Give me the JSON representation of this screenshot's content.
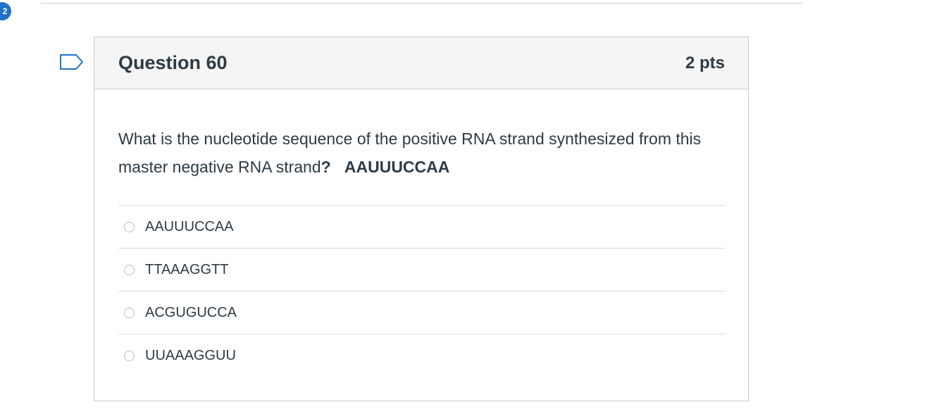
{
  "progress_badge": "2",
  "question": {
    "title": "Question 60",
    "points": "2 pts",
    "text_part1": "What is  the nucleotide  sequence  of the positive RNA strand synthesized from this master negative RNA  strand",
    "text_part2": "?",
    "text_bold": "AAUUUCCAA"
  },
  "answers": [
    {
      "label": "AAUUUCCAA",
      "selected": false
    },
    {
      "label": "TTAAAGGTT",
      "selected": false
    },
    {
      "label": "ACGUGUCCA",
      "selected": false
    },
    {
      "label": "UUAAAGGUU",
      "selected": false
    }
  ],
  "icons": {
    "flag": "flag-outline-icon",
    "badge": "numbered-badge-icon"
  },
  "colors": {
    "badge": "#1f72c9",
    "header_bg": "#f5f5f5",
    "border": "#c7cdd1",
    "text": "#2d3b45"
  }
}
